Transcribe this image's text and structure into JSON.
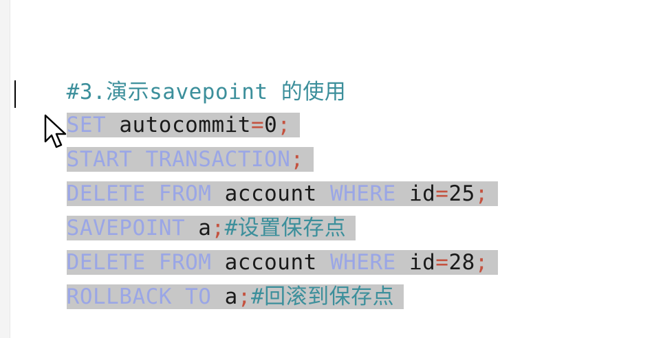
{
  "lines": [
    {
      "parts": [
        {
          "t": "#3.演示savepoint 的使用",
          "c": "comment"
        }
      ],
      "selected": false
    },
    {
      "parts": [
        {
          "t": "SET",
          "c": "kw"
        },
        {
          "t": " autocommit",
          "c": "txt"
        },
        {
          "t": "=",
          "c": "op"
        },
        {
          "t": "0",
          "c": "txt"
        },
        {
          "t": ";",
          "c": "op"
        }
      ],
      "selected": true
    },
    {
      "parts": [
        {
          "t": "START TRANSACTION",
          "c": "kw"
        },
        {
          "t": ";",
          "c": "op"
        }
      ],
      "selected": true
    },
    {
      "parts": [
        {
          "t": "DELETE FROM",
          "c": "kw"
        },
        {
          "t": " account ",
          "c": "txt"
        },
        {
          "t": "WHERE",
          "c": "kw"
        },
        {
          "t": " id",
          "c": "txt"
        },
        {
          "t": "=",
          "c": "op"
        },
        {
          "t": "25",
          "c": "txt"
        },
        {
          "t": ";",
          "c": "op"
        }
      ],
      "selected": true
    },
    {
      "parts": [
        {
          "t": "SAVEPOINT",
          "c": "kw"
        },
        {
          "t": " a",
          "c": "txt"
        },
        {
          "t": ";",
          "c": "op"
        },
        {
          "t": "#设置保存点",
          "c": "comment"
        }
      ],
      "selected": true
    },
    {
      "parts": [
        {
          "t": "DELETE FROM",
          "c": "kw"
        },
        {
          "t": " account ",
          "c": "txt"
        },
        {
          "t": "WHERE",
          "c": "kw"
        },
        {
          "t": " id",
          "c": "txt"
        },
        {
          "t": "=",
          "c": "op"
        },
        {
          "t": "28",
          "c": "txt"
        },
        {
          "t": ";",
          "c": "op"
        }
      ],
      "selected": true
    },
    {
      "parts": [
        {
          "t": "ROLLBACK TO",
          "c": "kw"
        },
        {
          "t": " a",
          "c": "txt"
        },
        {
          "t": ";",
          "c": "op"
        },
        {
          "t": "#回滚到保存点",
          "c": "comment"
        }
      ],
      "selected": true
    }
  ],
  "icons": {
    "cursor": "arrow-pointer-icon"
  },
  "colors": {
    "keyword": "#9aa6e6",
    "comment": "#3c8f9b",
    "operator": "#c4523f",
    "text": "#1a1a1a",
    "selection": "#c7c7c7"
  }
}
